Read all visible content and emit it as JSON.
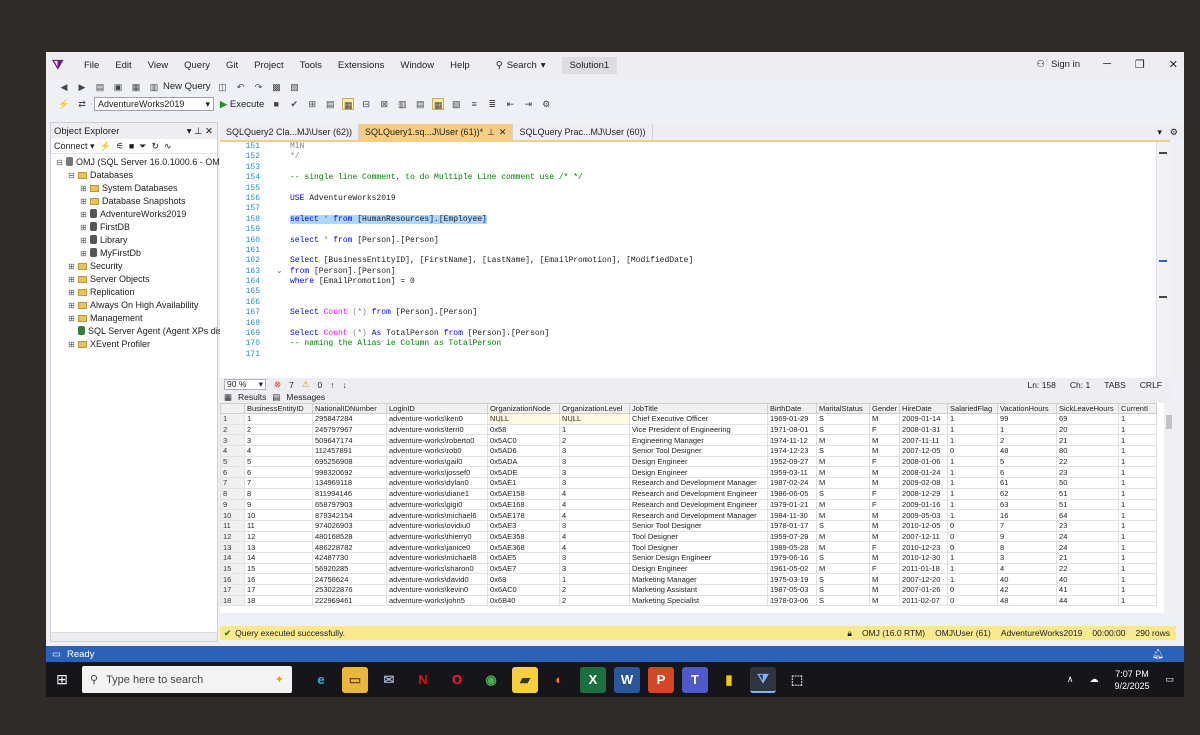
{
  "menu": [
    "File",
    "Edit",
    "View",
    "Query",
    "Git",
    "Project",
    "Tools",
    "Extensions",
    "Window",
    "Help"
  ],
  "search_label": "Search",
  "solution_label": "Solution1",
  "signin_label": "Sign in",
  "toolbar": {
    "new_query": "New Query",
    "database": "AdventureWorks2019",
    "execute": "Execute"
  },
  "object_explorer": {
    "title": "Object Explorer",
    "connect": "Connect",
    "tree": [
      {
        "label": "OMJ (SQL Server 16.0.1000.6 - OMJ\\",
        "level": 0,
        "exp": "⊟",
        "type": "server"
      },
      {
        "label": "Databases",
        "level": 1,
        "exp": "⊟",
        "type": "folder"
      },
      {
        "label": "System Databases",
        "level": 2,
        "exp": "⊞",
        "type": "folder"
      },
      {
        "label": "Database Snapshots",
        "level": 2,
        "exp": "⊞",
        "type": "folder"
      },
      {
        "label": "AdventureWorks2019",
        "level": 2,
        "exp": "⊞",
        "type": "db"
      },
      {
        "label": "FirstDB",
        "level": 2,
        "exp": "⊞",
        "type": "db"
      },
      {
        "label": "Library",
        "level": 2,
        "exp": "⊞",
        "type": "db"
      },
      {
        "label": "MyFirstDb",
        "level": 2,
        "exp": "⊞",
        "type": "db"
      },
      {
        "label": "Security",
        "level": 1,
        "exp": "⊞",
        "type": "folder"
      },
      {
        "label": "Server Objects",
        "level": 1,
        "exp": "⊞",
        "type": "folder"
      },
      {
        "label": "Replication",
        "level": 1,
        "exp": "⊞",
        "type": "folder"
      },
      {
        "label": "Always On High Availability",
        "level": 1,
        "exp": "⊞",
        "type": "folder"
      },
      {
        "label": "Management",
        "level": 1,
        "exp": "⊞",
        "type": "folder"
      },
      {
        "label": "SQL Server Agent (Agent XPs disa",
        "level": 1,
        "exp": "",
        "type": "agent"
      },
      {
        "label": "XEvent Profiler",
        "level": 1,
        "exp": "⊞",
        "type": "folder"
      }
    ]
  },
  "tabs": [
    {
      "label": "SQLQuery2 Cla...MJ\\User (62))",
      "active": false
    },
    {
      "label": "SQLQuery1.sq...J\\User (61))*",
      "active": true
    },
    {
      "label": "SQLQuery Prac...MJ\\User (60))",
      "active": false
    }
  ],
  "code_lines": [
    {
      "n": "151",
      "parts": [
        {
          "t": "MIN",
          "c": "gy"
        }
      ]
    },
    {
      "n": "152",
      "parts": [
        {
          "t": "*/",
          "c": "gy"
        }
      ]
    },
    {
      "n": "153",
      "parts": []
    },
    {
      "n": "154",
      "parts": [
        {
          "t": "-- single line Comment, to do Multiple Line comment use /* */",
          "c": "cm"
        }
      ]
    },
    {
      "n": "155",
      "parts": []
    },
    {
      "n": "156",
      "parts": [
        {
          "t": "USE ",
          "c": "kw"
        },
        {
          "t": "AdventureWorks2019",
          "c": ""
        }
      ]
    },
    {
      "n": "157",
      "parts": []
    },
    {
      "n": "158",
      "parts": [
        {
          "t": "select",
          "c": "kw selq"
        },
        {
          "t": " * ",
          "c": "gy selq"
        },
        {
          "t": "from",
          "c": "kw selq"
        },
        {
          "t": " [HumanResources].[Employee]",
          "c": "selq"
        }
      ]
    },
    {
      "n": "159",
      "parts": []
    },
    {
      "n": "160",
      "parts": [
        {
          "t": "select",
          "c": "kw"
        },
        {
          "t": " * ",
          "c": "gy"
        },
        {
          "t": "from",
          "c": "kw"
        },
        {
          "t": " [Person].[Person]",
          "c": ""
        }
      ]
    },
    {
      "n": "161",
      "parts": []
    },
    {
      "n": "162",
      "parts": [
        {
          "t": "Select",
          "c": "kw"
        },
        {
          "t": " [BusinessEntityID], [FirstName], [LastName], [EmailPromotion], [ModifiedDate]",
          "c": ""
        }
      ]
    },
    {
      "n": "163",
      "parts": [
        {
          "t": "from",
          "c": "kw"
        },
        {
          "t": " [Person].[Person]",
          "c": ""
        }
      ]
    },
    {
      "n": "164",
      "parts": [
        {
          "t": "where",
          "c": "kw"
        },
        {
          "t": " [EmailPromotion] = 0",
          "c": ""
        }
      ]
    },
    {
      "n": "165",
      "parts": []
    },
    {
      "n": "166",
      "parts": []
    },
    {
      "n": "167",
      "parts": [
        {
          "t": "Select ",
          "c": "kw"
        },
        {
          "t": "Count",
          "c": "fn"
        },
        {
          "t": " (*) ",
          "c": "gy"
        },
        {
          "t": "from",
          "c": "kw"
        },
        {
          "t": " [Person].[Person]",
          "c": ""
        }
      ]
    },
    {
      "n": "168",
      "parts": []
    },
    {
      "n": "169",
      "parts": [
        {
          "t": "Select ",
          "c": "kw"
        },
        {
          "t": "Count",
          "c": "fn"
        },
        {
          "t": " (*) ",
          "c": "gy"
        },
        {
          "t": "As",
          "c": "kw"
        },
        {
          "t": " TotalPerson ",
          "c": ""
        },
        {
          "t": "from",
          "c": "kw"
        },
        {
          "t": " [Person].[Person]",
          "c": ""
        }
      ]
    },
    {
      "n": "170",
      "parts": [
        {
          "t": "-- naming the Alias ie Column as TotalPerson",
          "c": "cm"
        }
      ]
    },
    {
      "n": "171",
      "parts": []
    }
  ],
  "editor_status": {
    "zoom": "90 %",
    "errors": "7",
    "warnings": "0",
    "ln": "Ln: 158",
    "ch": "Ch: 1",
    "tabs": "TABS",
    "crlf": "CRLF"
  },
  "results_tabs": {
    "results": "Results",
    "messages": "Messages"
  },
  "grid": {
    "columns": [
      "",
      "BusinessEntityID",
      "NationalIDNumber",
      "LoginID",
      "OrganizationNode",
      "OrganizationLevel",
      "JobTitle",
      "BirthDate",
      "MaritalStatus",
      "Gender",
      "HireDate",
      "SalariedFlag",
      "VacationHours",
      "SickLeaveHours",
      "CurrentI"
    ],
    "rows": [
      [
        "1",
        "1",
        "295847284",
        "adventure-works\\ken0",
        "NULL",
        "NULL",
        "Chief Executive Officer",
        "1969-01-29",
        "S",
        "M",
        "2009-01-14",
        "1",
        "99",
        "69",
        "1"
      ],
      [
        "2",
        "2",
        "245797967",
        "adventure-works\\terri0",
        "0x58",
        "1",
        "Vice President of Engineering",
        "1971-08-01",
        "S",
        "F",
        "2008-01-31",
        "1",
        "1",
        "20",
        "1"
      ],
      [
        "3",
        "3",
        "509647174",
        "adventure-works\\roberto0",
        "0x5AC0",
        "2",
        "Engineering Manager",
        "1974-11-12",
        "M",
        "M",
        "2007-11-11",
        "1",
        "2",
        "21",
        "1"
      ],
      [
        "4",
        "4",
        "112457891",
        "adventure-works\\rob0",
        "0x5AD6",
        "3",
        "Senior Tool Designer",
        "1974-12-23",
        "S",
        "M",
        "2007-12-05",
        "0",
        "48",
        "80",
        "1"
      ],
      [
        "5",
        "5",
        "695256908",
        "adventure-works\\gail0",
        "0x5ADA",
        "3",
        "Design Engineer",
        "1952-09-27",
        "M",
        "F",
        "2008-01-06",
        "1",
        "5",
        "22",
        "1"
      ],
      [
        "6",
        "6",
        "998320692",
        "adventure-works\\jossef0",
        "0x5ADE",
        "3",
        "Design Engineer",
        "1959-03-11",
        "M",
        "M",
        "2008-01-24",
        "1",
        "6",
        "23",
        "1"
      ],
      [
        "7",
        "7",
        "134969118",
        "adventure-works\\dylan0",
        "0x5AE1",
        "3",
        "Research and Development Manager",
        "1987-02-24",
        "M",
        "M",
        "2009-02-08",
        "1",
        "61",
        "50",
        "1"
      ],
      [
        "8",
        "8",
        "811994146",
        "adventure-works\\diane1",
        "0x5AE158",
        "4",
        "Research and Development Engineer",
        "1986-06-05",
        "S",
        "F",
        "2008-12-29",
        "1",
        "62",
        "51",
        "1"
      ],
      [
        "9",
        "9",
        "658797903",
        "adventure-works\\gigi0",
        "0x5AE168",
        "4",
        "Research and Development Engineer",
        "1979-01-21",
        "M",
        "F",
        "2009-01-16",
        "1",
        "63",
        "51",
        "1"
      ],
      [
        "10",
        "10",
        "879342154",
        "adventure-works\\michael6",
        "0x5AE178",
        "4",
        "Research and Development Manager",
        "1984-11-30",
        "M",
        "M",
        "2009-05-03",
        "1",
        "16",
        "64",
        "1"
      ],
      [
        "11",
        "11",
        "974026903",
        "adventure-works\\ovidiu0",
        "0x5AE3",
        "3",
        "Senior Tool Designer",
        "1978-01-17",
        "S",
        "M",
        "2010-12-05",
        "0",
        "7",
        "23",
        "1"
      ],
      [
        "12",
        "12",
        "480168528",
        "adventure-works\\thierry0",
        "0x5AE358",
        "4",
        "Tool Designer",
        "1959-07-29",
        "M",
        "M",
        "2007-12-11",
        "0",
        "9",
        "24",
        "1"
      ],
      [
        "13",
        "13",
        "486228782",
        "adventure-works\\janice0",
        "0x5AE368",
        "4",
        "Tool Designer",
        "1989-05-28",
        "M",
        "F",
        "2010-12-23",
        "0",
        "8",
        "24",
        "1"
      ],
      [
        "14",
        "14",
        "42487730",
        "adventure-works\\michael8",
        "0x5AE5",
        "3",
        "Senior Design Engineer",
        "1979-06-16",
        "S",
        "M",
        "2010-12-30",
        "1",
        "3",
        "21",
        "1"
      ],
      [
        "15",
        "15",
        "56920285",
        "adventure-works\\sharon0",
        "0x5AE7",
        "3",
        "Design Engineer",
        "1961-05-02",
        "M",
        "F",
        "2011-01-18",
        "1",
        "4",
        "22",
        "1"
      ],
      [
        "16",
        "16",
        "24756624",
        "adventure-works\\david0",
        "0x68",
        "1",
        "Marketing Manager",
        "1975-03-19",
        "S",
        "M",
        "2007-12-20",
        "1",
        "40",
        "40",
        "1"
      ],
      [
        "17",
        "17",
        "253022876",
        "adventure-works\\kevin0",
        "0x6AC0",
        "2",
        "Marketing Assistant",
        "1987-05-03",
        "S",
        "M",
        "2007-01-26",
        "0",
        "42",
        "41",
        "1"
      ],
      [
        "18",
        "18",
        "222969461",
        "adventure-works\\john5",
        "0x6B40",
        "2",
        "Marketing Specialist",
        "1978-03-06",
        "S",
        "M",
        "2011-02-07",
        "0",
        "48",
        "44",
        "1"
      ]
    ]
  },
  "query_status": {
    "message": "Query executed successfully.",
    "server": "OMJ (16.0 RTM)",
    "user": "OMJ\\User (61)",
    "db": "AdventureWorks2019",
    "time": "00:00:00",
    "rows": "290 rows"
  },
  "statusbar": {
    "text": "Ready"
  },
  "taskbar": {
    "search": "Type here to search",
    "time": "7:07 PM",
    "date": "9/2/2025"
  }
}
